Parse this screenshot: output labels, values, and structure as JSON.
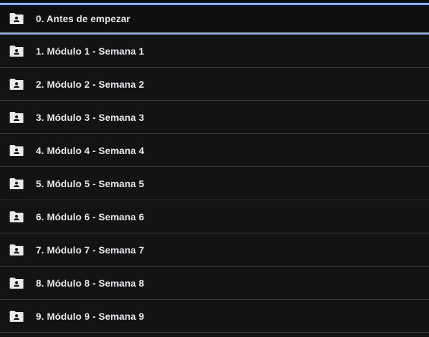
{
  "folders": [
    {
      "label": "0. Antes de empezar",
      "icon": "shared-folder-icon"
    },
    {
      "label": "1. Módulo 1 - Semana 1",
      "icon": "shared-folder-icon"
    },
    {
      "label": "2. Módulo 2 - Semana 2",
      "icon": "shared-folder-icon"
    },
    {
      "label": "3. Módulo 3 - Semana 3",
      "icon": "shared-folder-icon"
    },
    {
      "label": "4. Módulo 4 - Semana 4",
      "icon": "shared-folder-icon"
    },
    {
      "label": "5. Módulo 5 - Semana 5",
      "icon": "shared-folder-icon"
    },
    {
      "label": "6. Módulo 6 - Semana 6",
      "icon": "shared-folder-icon"
    },
    {
      "label": "7. Módulo 7 - Semana 7",
      "icon": "shared-folder-icon"
    },
    {
      "label": "8. Módulo 8 - Semana 8",
      "icon": "shared-folder-icon"
    },
    {
      "label": "9. Módulo 9 - Semana 9",
      "icon": "shared-folder-icon"
    }
  ],
  "colors": {
    "background": "#131313",
    "selection_border": "#8ab4f8",
    "text": "#e8eaed",
    "icon": "#e8eaed",
    "divider": "#3a3a3a"
  }
}
